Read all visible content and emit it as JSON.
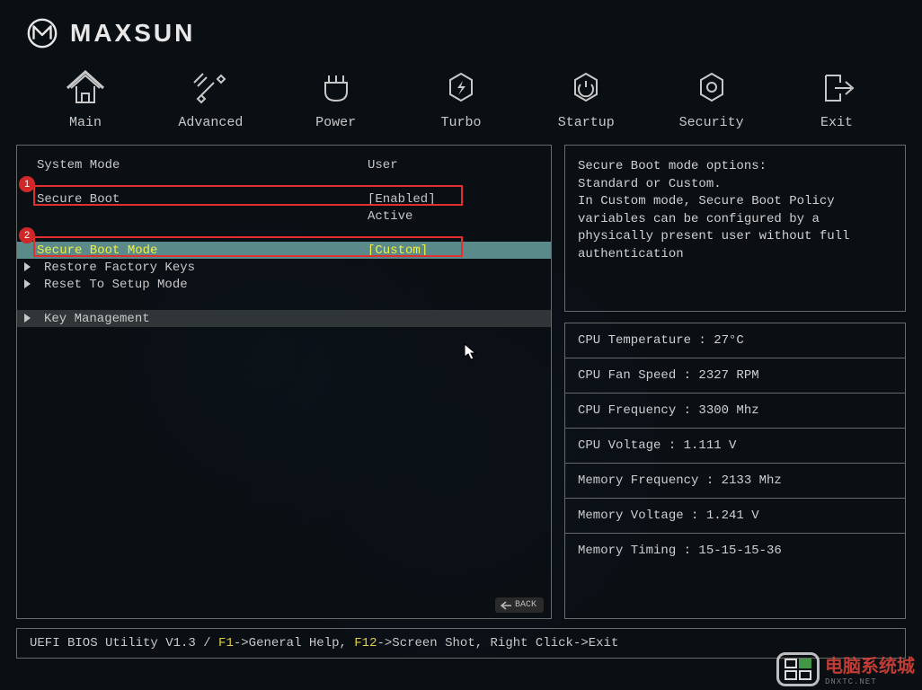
{
  "brand": "MAXSUN",
  "nav": [
    {
      "id": "main",
      "label": "Main"
    },
    {
      "id": "advanced",
      "label": "Advanced"
    },
    {
      "id": "power",
      "label": "Power"
    },
    {
      "id": "turbo",
      "label": "Turbo"
    },
    {
      "id": "startup",
      "label": "Startup"
    },
    {
      "id": "security",
      "label": "Security"
    },
    {
      "id": "exit",
      "label": "Exit"
    }
  ],
  "settings": {
    "system_mode": {
      "label": "System Mode",
      "value": "User"
    },
    "secure_boot": {
      "label": "Secure Boot",
      "value": "[Enabled]"
    },
    "secure_boot_status": {
      "value": "Active"
    },
    "secure_boot_mode": {
      "label": "Secure Boot Mode",
      "value": "[Custom]"
    },
    "restore_factory_keys": {
      "label": "Restore Factory Keys"
    },
    "reset_to_setup_mode": {
      "label": "Reset To Setup Mode"
    },
    "key_management": {
      "label": "Key Management"
    }
  },
  "annotations": [
    {
      "badge": "1"
    },
    {
      "badge": "2"
    }
  ],
  "help_text": "Secure Boot mode options:\nStandard or Custom.\nIn Custom mode, Secure Boot Policy variables can be configured by a physically present user without full authentication",
  "stats": {
    "cpu_temp": "CPU Temperature : 27°C",
    "cpu_fan": "CPU Fan Speed : 2327 RPM",
    "cpu_freq": "CPU Frequency : 3300 Mhz",
    "cpu_volt": "CPU Voltage : 1.111 V",
    "mem_freq": "Memory Frequency : 2133 Mhz",
    "mem_volt": "Memory Voltage : 1.241 V",
    "mem_timing": "Memory Timing : 15-15-15-36"
  },
  "back_label": "BACK",
  "footer": {
    "prefix": "UEFI BIOS Utility V1.3 / ",
    "f1": "F1",
    "f1_text": "->General Help, ",
    "f12": "F12",
    "f12_text": "->Screen Shot, Right Click->Exit"
  },
  "watermark": {
    "text": "电脑系统城",
    "sub": "DNXTC.NET"
  }
}
